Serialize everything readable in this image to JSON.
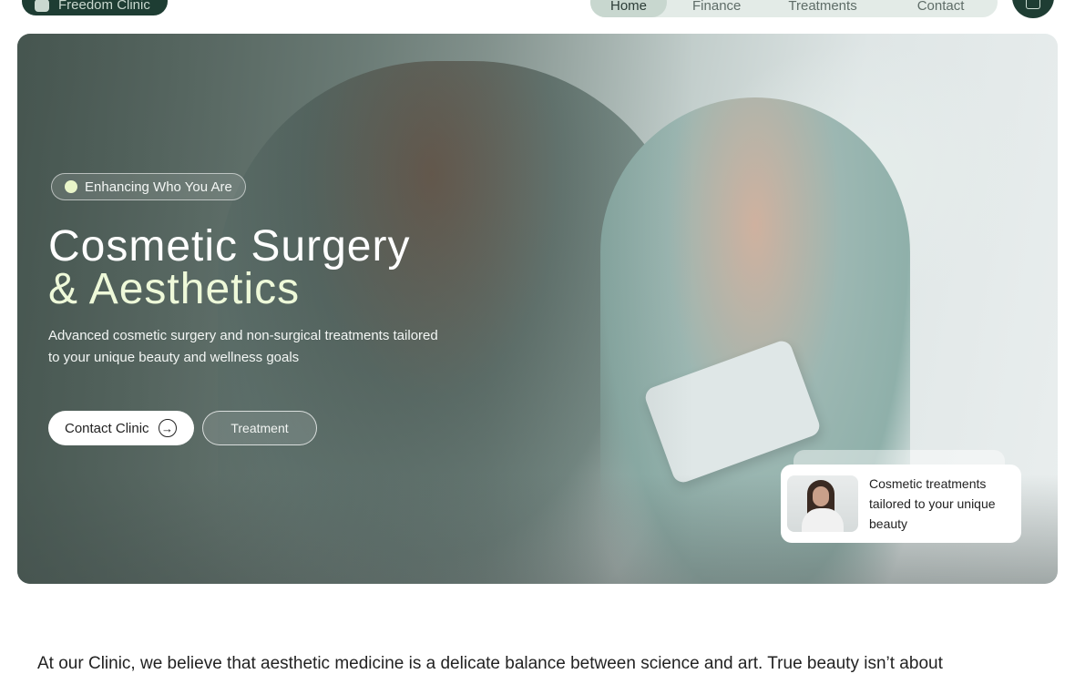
{
  "nav": {
    "brand": "Freedom Clinic",
    "items": [
      "Home",
      "Finance",
      "Treatments",
      "Contact"
    ],
    "active": "Home"
  },
  "hero": {
    "tagline": "Enhancing Who You Are",
    "headline_line1": "Cosmetic Surgery",
    "headline_line2": "& Aesthetics",
    "subtext": "Advanced cosmetic surgery and non-surgical treatments tailored to your unique beauty and wellness goals",
    "buttons": {
      "contact": "Contact Clinic",
      "treatment": "Treatment"
    },
    "card_text": "Cosmetic treatments tailored to your unique beauty"
  },
  "intro": {
    "text": "At our Clinic, we believe that aesthetic medicine is a delicate balance between science and art. True beauty isn’t about"
  },
  "colors": {
    "brand_green": "#1e3d33",
    "nav_bg": "#e3ebe7",
    "headline_accent": "#eef9d9"
  },
  "icons": {
    "cart": "shopping-bag-icon",
    "arrow": "arrow-right-circle-icon"
  }
}
